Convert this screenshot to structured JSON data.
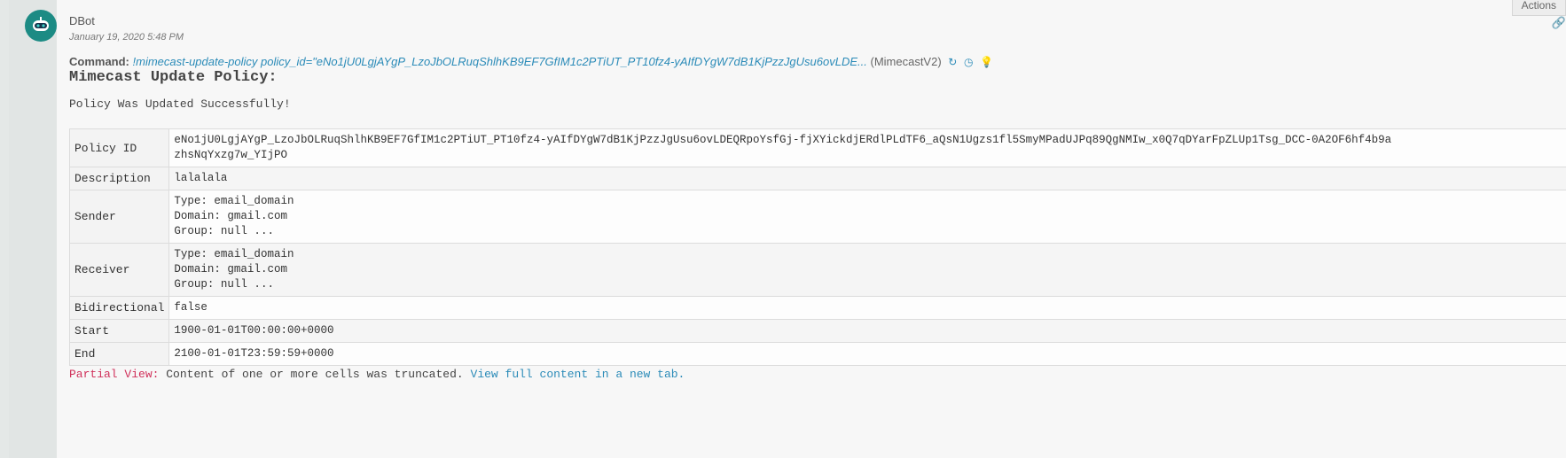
{
  "entry": {
    "author": "DBot",
    "timestamp": "January 19, 2020 5:48 PM",
    "actions_label": "Actions"
  },
  "command": {
    "label": "Command:",
    "text": "!mimecast-update-policy policy_id=\"eNo1jU0LgjAYgP_LzoJbOLRuqShlhKB9EF7GfIM1c2PTiUT_PT10fz4-yAIfDYgW7dB1KjPzzJgUsu6ovLDE...",
    "brand": "(MimecastV2)",
    "icons": [
      "refresh-icon",
      "clock-icon",
      "lightbulb-icon"
    ]
  },
  "heading": "Mimecast Update Policy:",
  "message": "Policy Was Updated Successfully!",
  "table": {
    "rows": [
      {
        "key": "Policy ID",
        "value": "eNo1jU0LgjAYgP_LzoJbOLRuqShlhKB9EF7GfIM1c2PTiUT_PT10fz4-yAIfDYgW7dB1KjPzzJgUsu6ovLDEQRpoYsfGj-fjXYickdjERdlPLdTF6_aQsN1Ugzs1fl5SmyMPadUJPq89QgNMIw_x0Q7qDYarFpZLUp1Tsg_DCC-0A2OF6hf4b9a\nzhsNqYxzg7w_YIjPO"
      },
      {
        "key": "Description",
        "value": "lalalala"
      },
      {
        "key": "Sender",
        "value": "Type: email_domain\nDomain: gmail.com\nGroup: null ..."
      },
      {
        "key": "Receiver",
        "value": "Type: email_domain\nDomain: gmail.com\nGroup: null ..."
      },
      {
        "key": "Bidirectional",
        "value": "false"
      },
      {
        "key": "Start",
        "value": "1900-01-01T00:00:00+0000"
      },
      {
        "key": "End",
        "value": "2100-01-01T23:59:59+0000"
      }
    ]
  },
  "partial": {
    "label": "Partial View:",
    "text": "Content of one or more cells was truncated.",
    "link": "View full content in a new tab."
  }
}
